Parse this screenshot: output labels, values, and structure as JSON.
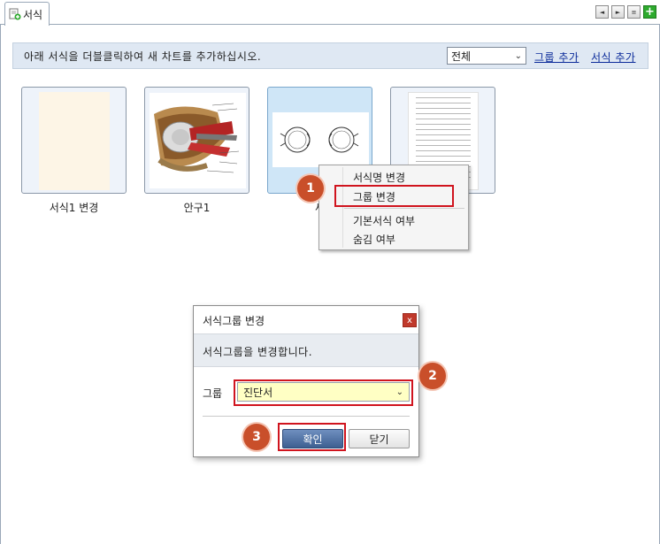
{
  "tabs": [
    {
      "label": "서식"
    }
  ],
  "toolbar": {
    "prev_icon": "◄",
    "next_icon": "►",
    "list_icon": "≡",
    "add_icon": "+"
  },
  "infobar": {
    "text": "아래 서식을 더블클릭하여 새 차트를 추가하십시오.",
    "filter_value": "전체",
    "add_group_link": "그룹 추가",
    "add_form_link": "서식 추가"
  },
  "templates": [
    {
      "label": "서식1 변경"
    },
    {
      "label": "안구1"
    },
    {
      "label": "새"
    },
    {
      "label": ""
    }
  ],
  "context_menu": {
    "items": [
      "서식명 변경",
      "그룹 변경",
      "기본서식 여부",
      "숨김 여부"
    ]
  },
  "dialog": {
    "title": "서식그룹 변경",
    "close_label": "x",
    "description": "서식그룹을 변경합니다.",
    "field_label": "그룹",
    "selected_group": "진단서",
    "ok_label": "확인",
    "cancel_label": "닫기"
  },
  "callouts": [
    "1",
    "2",
    "3"
  ],
  "colors": {
    "highlight": "#d0141e",
    "callout": "#c94f2a",
    "primary_button": "#4a6aa0",
    "select_bg": "#ffffc4"
  }
}
